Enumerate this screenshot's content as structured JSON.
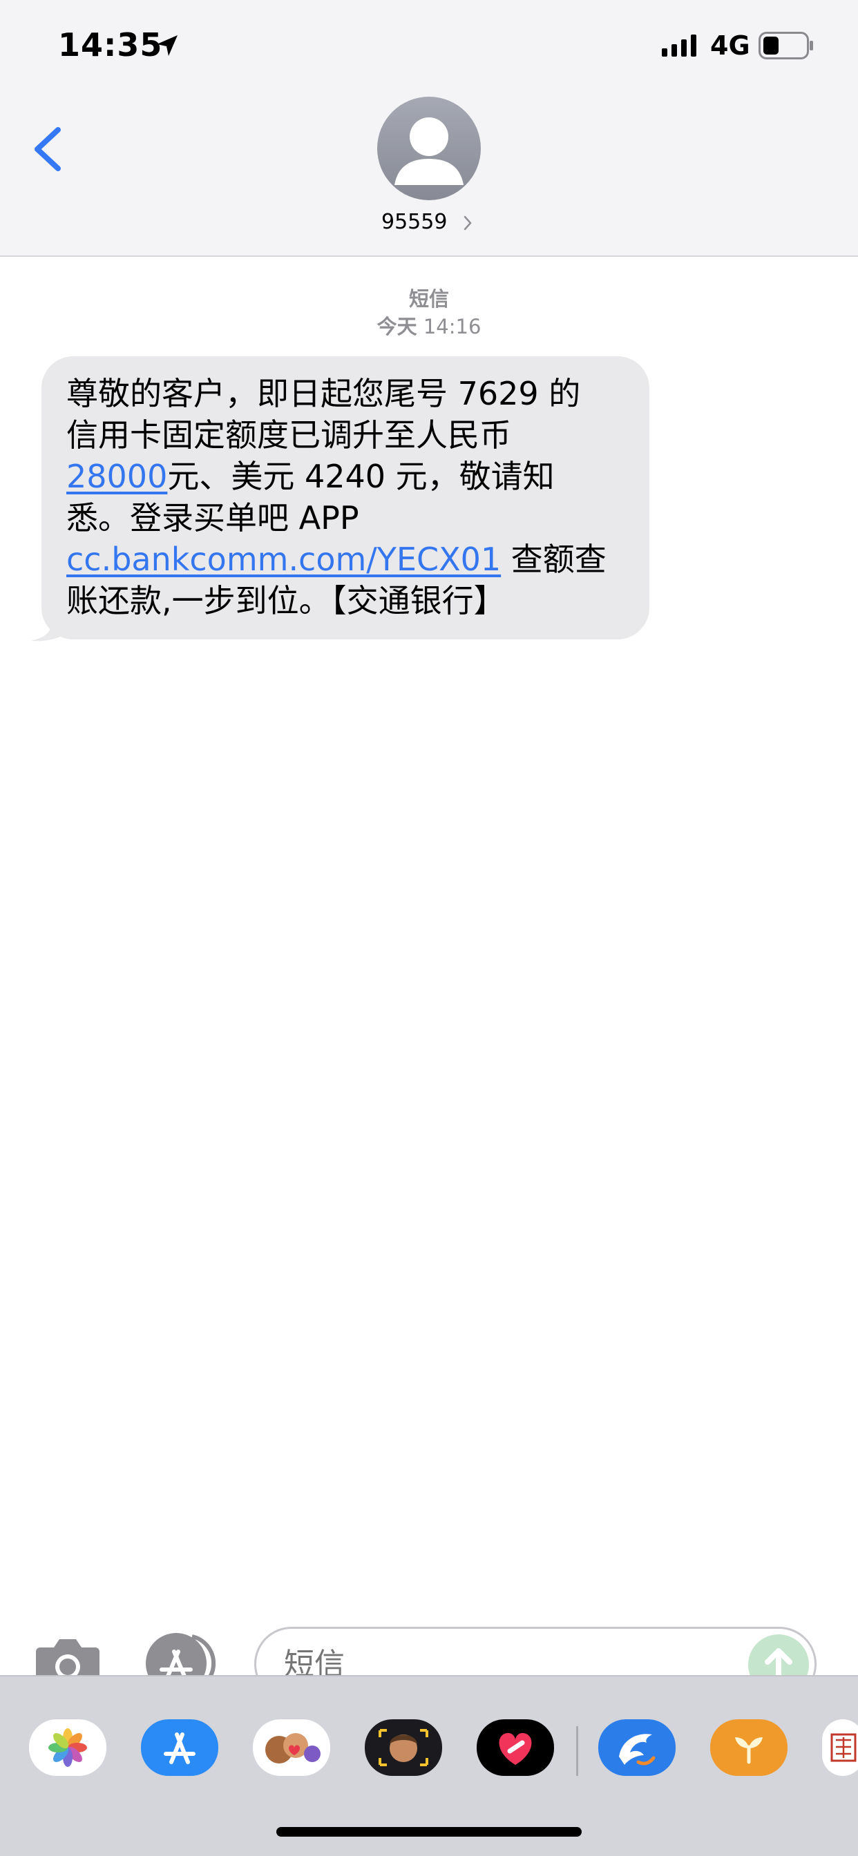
{
  "status_bar": {
    "time": "14:35",
    "network": "4G"
  },
  "header": {
    "contact_name": "95559"
  },
  "thread": {
    "service_label": "短信",
    "day_label": "今天",
    "time_label": "14:16"
  },
  "message": {
    "line1": "尊敬的客户，即日起您尾号 7629 的",
    "line2": "信用卡固定额度已调升至人民币",
    "line3_link": "28000",
    "line3_rest": "元、美元 4240 元，敬请知",
    "line4": "悉。登录买单吧 APP",
    "line5_link": "cc.bankcomm.com/YECX01",
    "line5_rest": " 查额查",
    "line6": "账还款,一步到位。【交通银行】"
  },
  "compose": {
    "placeholder": "短信"
  },
  "app_drawer": {
    "apps": [
      "photos-icon",
      "app-store-icon",
      "memoji-stickers-icon",
      "animoji-icon",
      "digital-touch-icon",
      "dolphin-app-icon",
      "sprout-app-icon",
      "stamp-app-icon"
    ]
  },
  "colors": {
    "link": "#3476f0",
    "bubble_received": "#e9e9eb",
    "back_chevron": "#3478f6"
  }
}
